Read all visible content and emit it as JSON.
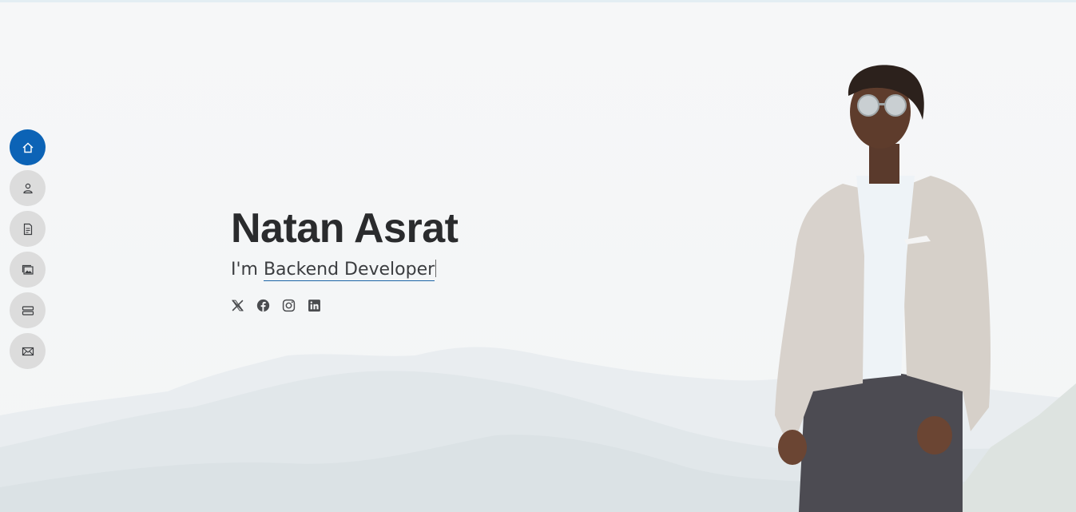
{
  "hero": {
    "name": "Natan Asrat",
    "prefix": "I'm",
    "typed_role": "Backend Developer"
  },
  "sidenav": {
    "items": [
      {
        "name": "home",
        "icon": "home-icon",
        "active": true
      },
      {
        "name": "about",
        "icon": "person-icon",
        "active": false
      },
      {
        "name": "resume",
        "icon": "file-icon",
        "active": false
      },
      {
        "name": "portfolio",
        "icon": "images-icon",
        "active": false
      },
      {
        "name": "services",
        "icon": "server-icon",
        "active": false
      },
      {
        "name": "contact",
        "icon": "envelope-icon",
        "active": false
      }
    ]
  },
  "social": [
    "x-twitter-icon",
    "facebook-icon",
    "instagram-icon",
    "linkedin-icon"
  ],
  "colors": {
    "accent": "#0c63b6",
    "nav_inactive": "#dcdcdc",
    "name_text": "#2a2b2d"
  }
}
